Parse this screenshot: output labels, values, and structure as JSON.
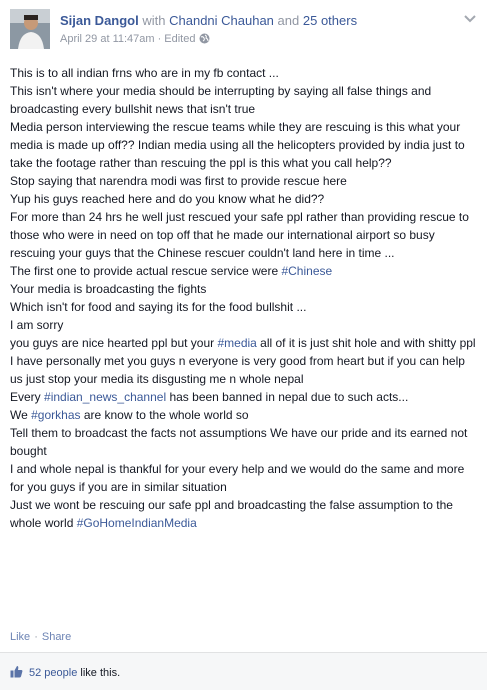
{
  "header": {
    "author": "Sijan Dangol",
    "with_word": "with",
    "tagged_person": "Chandni Chauhan",
    "and_word": "and",
    "others": "25 others",
    "timestamp": "April 29 at 11:47am",
    "separator": "·",
    "edited": "Edited",
    "menu_icon": "chevron-down-icon",
    "privacy_icon": "globe-icon"
  },
  "body": {
    "lines": [
      [
        {
          "t": "This is to all indian frns who are in my fb contact ..."
        }
      ],
      [
        {
          "t": "This isn't where your media should be interrupting by saying all false things and broadcasting every bullshit news that isn't true"
        }
      ],
      [
        {
          "t": "Media person interviewing the rescue teams while they are rescuing is this what your media is made up off?? Indian media using all the helicopters provided by india just to take the footage rather than rescuing the ppl is this what you call help??"
        }
      ],
      [
        {
          "t": "Stop saying that narendra modi was first to provide rescue here"
        }
      ],
      [
        {
          "t": "Yup his guys reached here and do you know what he did??"
        }
      ],
      [
        {
          "t": "For more than 24 hrs he well just rescued your safe ppl rather than providing rescue to those who were in need on top off that he made our international airport so busy rescuing your guys that the Chinese rescuer couldn't land here in time ..."
        }
      ],
      [
        {
          "t": "The first one to provide actual rescue service were "
        },
        {
          "t": "#Chinese",
          "tag": true
        }
      ],
      [
        {
          "t": "Your media is broadcasting the fights"
        }
      ],
      [
        {
          "t": "Which isn't for food and saying its for the food bullshit ..."
        }
      ],
      [
        {
          "t": "I am sorry"
        }
      ],
      [
        {
          "t": "you guys are nice hearted ppl but your "
        },
        {
          "t": "#media",
          "tag": true
        },
        {
          "t": " all of it is just shit hole and with shitty ppl"
        }
      ],
      [
        {
          "t": "I have personally met you guys n everyone is very good from heart but if you can help us just stop your media its disgusting me n whole nepal"
        }
      ],
      [
        {
          "t": "Every "
        },
        {
          "t": "#indian_news_channel",
          "tag": true
        },
        {
          "t": " has been banned in nepal due to such acts..."
        }
      ],
      [
        {
          "t": "We "
        },
        {
          "t": "#gorkhas",
          "tag": true
        },
        {
          "t": " are know to the whole world so"
        }
      ],
      [
        {
          "t": "Tell them to broadcast the facts not assumptions We have our pride and its earned not bought"
        }
      ],
      [
        {
          "t": "I and whole nepal is thankful for your every help and we would do the same and more for you guys if you are in similar situation"
        }
      ],
      [
        {
          "t": "Just we wont be rescuing our safe ppl and broadcasting the false assumption to the whole world "
        },
        {
          "t": "#GoHomeIndianMedia",
          "tag": true
        }
      ]
    ]
  },
  "actions": {
    "like": "Like",
    "dot": "·",
    "share": "Share"
  },
  "likes": {
    "icon": "thumbs-up-icon",
    "count": "52 people",
    "suffix": "like this."
  },
  "colors": {
    "link": "#3b5998",
    "muted": "#9197a3",
    "text": "#141823",
    "likes_bg": "#f6f7f8"
  }
}
